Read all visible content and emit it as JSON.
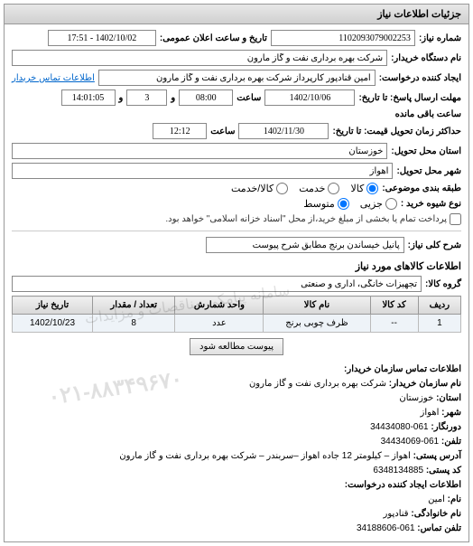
{
  "panel_title": "جزئیات اطلاعات نیاز",
  "fields": {
    "need_number_label": "شماره نیاز:",
    "need_number": "1102093079002253",
    "announce_label": "تاریخ و ساعت اعلان عمومی:",
    "announce_value": "1402/10/02 - 17:51",
    "buyer_org_label": "نام دستگاه خریدار:",
    "buyer_org": "شرکت بهره برداری نفت و گاز مارون",
    "requester_label": "ایجاد کننده درخواست:",
    "requester": "امین قنادپور کارپرداز شرکت بهره برداری نفت و گاز مارون",
    "contact_link": "اطلاعات تماس خریدار",
    "deadline_label": "مهلت ارسال پاسخ: تا تاریخ:",
    "deadline_date": "1402/10/06",
    "time_label": "ساعت",
    "deadline_time": "08:00",
    "and_label": "و",
    "days_remaining": "3",
    "remaining_time": "14:01:05",
    "remaining_label": "ساعت باقی مانده",
    "price_deadline_label": "حداکثر زمان تحویل قیمت: تا تاریخ:",
    "price_deadline_date": "1402/11/30",
    "price_deadline_time": "12:12",
    "province_label": "استان محل تحویل:",
    "province": "خوزستان",
    "city_label": "شهر محل تحویل:",
    "city": "اهواز",
    "subject_type_label": "طبقه بندی موضوعی:",
    "subject_kala": "کالا",
    "subject_service": "خدمت",
    "subject_both": "کالا/خدمت",
    "purchase_type_label": "نوع شیوه خرید :",
    "purchase_low": "جزیی",
    "purchase_mid": "متوسط",
    "purchase_note": "پرداخت تمام یا بخشی از مبلغ خرید،از محل \"اسناد خزانه اسلامی\" خواهد بود.",
    "need_title_label": "شرح کلی نیاز:",
    "need_title": "پانیل خیساندن برنج مطابق شرح پیوست",
    "items_section": "اطلاعات کالاهای مورد نیاز",
    "group_label": "گروه کالا:",
    "group_value": "تجهیزات خانگی، اداری و صنعتی",
    "attachment_btn": "پیوست مطالعه شود"
  },
  "table": {
    "headers": {
      "row": "ردیف",
      "code": "کد کالا",
      "name": "نام کالا",
      "unit": "واحد شمارش",
      "qty": "تعداد / مقدار",
      "date": "تاریخ نیاز"
    },
    "rows": [
      {
        "row": "1",
        "code": "--",
        "name": "ظرف چوبی برنج",
        "unit": "عدد",
        "qty": "8",
        "date": "1402/10/23"
      }
    ]
  },
  "contact": {
    "title": "اطلاعات تماس سازمان خریدار:",
    "org_label": "نام سازمان خریدار:",
    "org": "شرکت بهره برداری نفت و گاز مارون",
    "province_label": "استان:",
    "province": "خوزستان",
    "city_label": "شهر:",
    "city": "اهواز",
    "fax_label": "دورنگار:",
    "fax": "061-34434080",
    "phone_label": "تلفن:",
    "phone": "061-34434069",
    "address_label": "آدرس پستی:",
    "address": "اهواز – کیلومتر 12 جاده اهواز –سربندر – شرکت بهره برداری نفت و گاز مارون",
    "postal_label": "کد پستی:",
    "postal": "6348134885",
    "creator_title": "اطلاعات ایجاد کننده درخواست:",
    "name_label": "نام:",
    "name": "امین",
    "lastname_label": "نام خانوادگی:",
    "lastname": "قنادپور",
    "contact_phone_label": "تلفن تماس:",
    "contact_phone": "061-34188606"
  },
  "watermark": "۰۲۱-۸۸۳۴۹۶۷۰",
  "watermark2": "سامانه پیامکی مناقصات و مزایدات"
}
